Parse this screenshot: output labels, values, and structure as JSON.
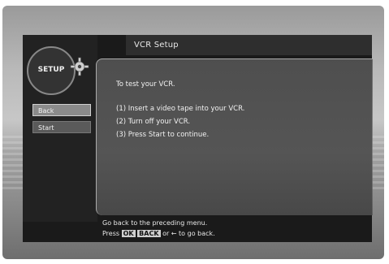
{
  "header": {
    "title": "VCR Setup"
  },
  "badge": {
    "label": "SETUP",
    "icon": "gear-icon"
  },
  "menu": {
    "back_label": "Back",
    "start_label": "Start"
  },
  "panel": {
    "intro": "To test your VCR.",
    "steps": [
      "(1) Insert a video tape into your VCR.",
      "(2) Turn off your VCR.",
      "(3) Press Start to continue."
    ]
  },
  "footer": {
    "line1": "Go back to the preceding menu.",
    "line2_prefix": "Press",
    "key_ok": "OK",
    "key_back": "BACK",
    "line2_suffix": "or ← to go back."
  }
}
